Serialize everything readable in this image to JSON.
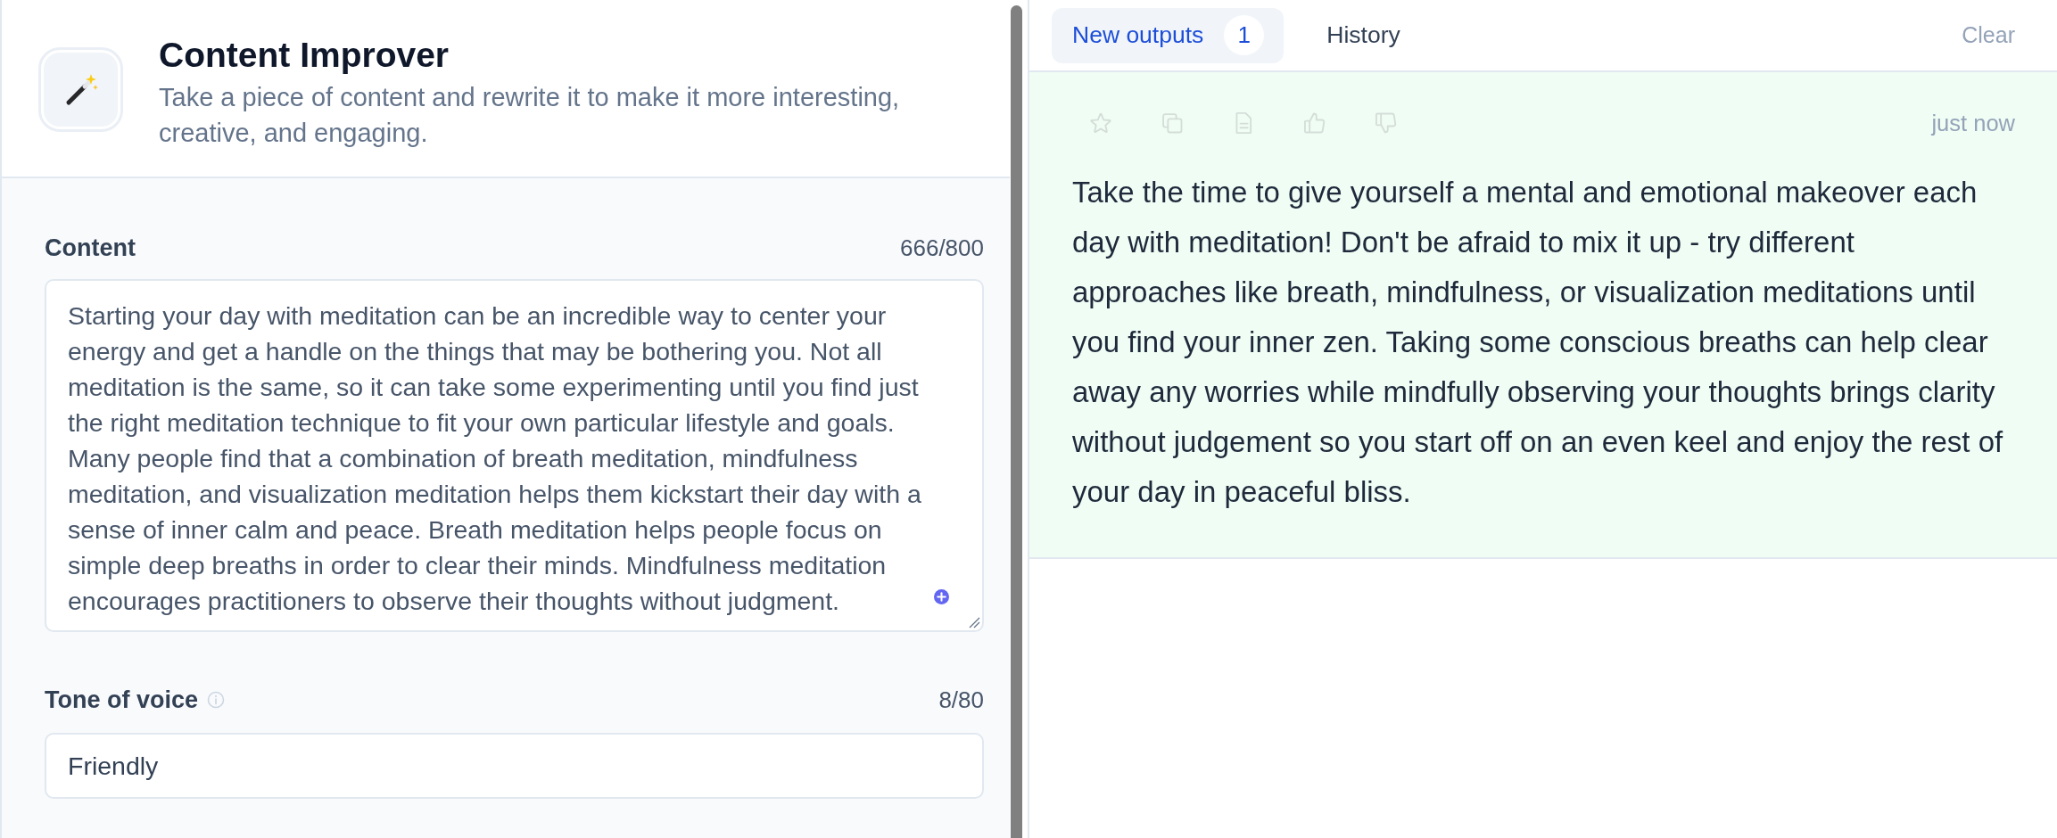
{
  "tool": {
    "title": "Content Improver",
    "description": "Take a piece of content and rewrite it to make it more interesting, creative, and engaging."
  },
  "form": {
    "fields": [
      {
        "kind": "textarea",
        "label": "Content",
        "info_icon": false,
        "counter": "666/800",
        "value": "Starting your day with meditation can be an incredible way to center your energy and get a handle on the things that may be bothering you. Not all meditation is the same, so it can take some experimenting until you find just the right meditation technique to fit your own particular lifestyle and goals. Many people find that a combination of breath meditation, mindfulness meditation, and visualization meditation helps them kickstart their day with a sense of inner calm and peace. Breath meditation helps people focus on simple deep breaths in order to clear their minds. Mindfulness meditation encourages practitioners to observe their thoughts without judgment."
      },
      {
        "kind": "input",
        "label": "Tone of voice",
        "info_icon": true,
        "counter": "8/80",
        "value": "Friendly"
      }
    ]
  },
  "outputs": {
    "tabs": [
      {
        "label": "New outputs",
        "badge": "1",
        "selected": true
      },
      {
        "label": "History",
        "selected": false
      }
    ],
    "clear": "Clear",
    "results": [
      {
        "time": "just now",
        "text": "Take the time to give yourself a mental and emotional makeover each day with meditation! Don't be afraid to mix it up - try different approaches like breath, mindfulness, or visualization meditations until you find your inner zen. Taking some conscious breaths can help clear away any worries while mindfully observing your thoughts brings clarity without judgement so you start off on an even keel and enjoy the rest of your day in peaceful bliss."
      }
    ]
  }
}
